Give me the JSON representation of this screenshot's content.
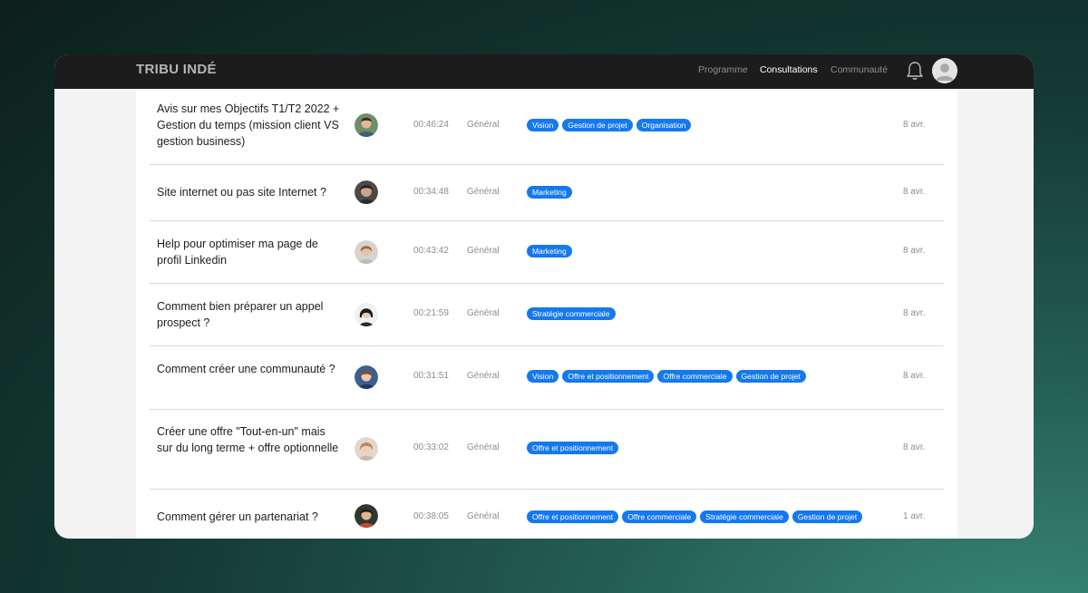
{
  "brand": {
    "name": "TRIBU INDÉ"
  },
  "nav": {
    "items": [
      "Programme",
      "Consultations",
      "Communauté"
    ],
    "active": "Consultations"
  },
  "colors": {
    "tag_bg": "#1579ee",
    "topbar": "#1c1c1c"
  },
  "icons": {
    "notifications": "bell-icon",
    "user": "user-avatar-icon"
  },
  "rows": [
    {
      "title": "Avis sur mes Objectifs T1/T2 2022 + Gestion du temps (mission client VS gestion business)",
      "duration": "00:46:24",
      "category": "Général",
      "tags": [
        "Vision",
        "Gestion de projet",
        "Organisation"
      ],
      "date": "8 avr."
    },
    {
      "title": "Site internet ou pas site Internet ?",
      "duration": "00:34:48",
      "category": "Général",
      "tags": [
        "Marketing"
      ],
      "date": "8 avr."
    },
    {
      "title": "Help pour optimiser ma page de profil Linkedin",
      "duration": "00:43:42",
      "category": "Général",
      "tags": [
        "Marketing"
      ],
      "date": "8 avr."
    },
    {
      "title": "Comment bien préparer un appel prospect ?",
      "duration": "00:21:59",
      "category": "Général",
      "tags": [
        "Stratégie commerciale"
      ],
      "date": "8 avr."
    },
    {
      "title": "Comment créer une communauté ?",
      "duration": "00:31:51",
      "category": "Général",
      "tags": [
        "Vision",
        "Offre et positionnement",
        "Offre commerciale",
        "Gestion de projet"
      ],
      "date": "8 avr."
    },
    {
      "title": "Créer une offre \"Tout-en-un\" mais sur du long terme + offre optionnelle",
      "duration": "00:33:02",
      "category": "Général",
      "tags": [
        "Offre et positionnement"
      ],
      "date": "8 avr."
    },
    {
      "title": "Comment gérer un partenariat ?",
      "duration": "00:38:05",
      "category": "Général",
      "tags": [
        "Offre et positionnement",
        "Offre commerciale",
        "Stratégie commerciale",
        "Gestion de projet"
      ],
      "date": "1 avr."
    }
  ]
}
